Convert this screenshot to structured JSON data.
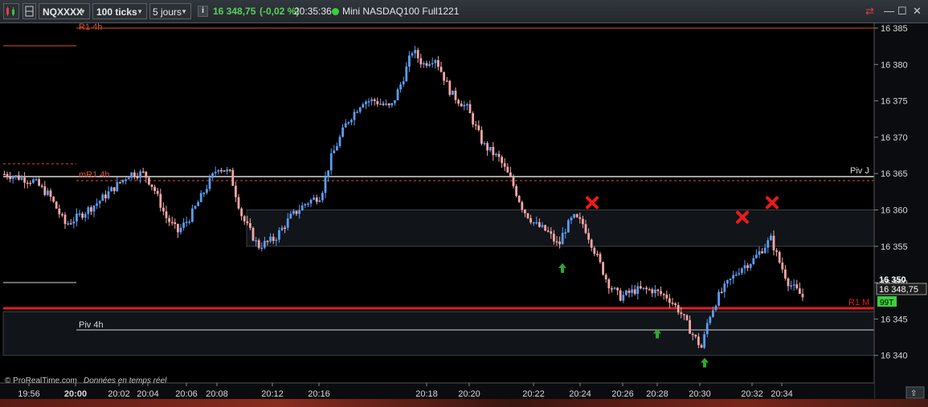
{
  "toolbar": {
    "symbol": "NQXXXX",
    "ticks": "100 ticks",
    "period": "5 jours",
    "price": "16 348,75",
    "change": "(-0,02 %)",
    "time": "20:35:36",
    "instrument": "Mini NASDAQ100 Full1221",
    "info_icon": "i"
  },
  "chart": {
    "copyright": "© ProRealTime.com",
    "data_note": "Données en temps réel",
    "current_price": "16 348,75",
    "current_price_display": "16 350",
    "tick_counter": "99T",
    "y_ticks": [
      "16 385",
      "16 380",
      "16 375",
      "16 370",
      "16 365",
      "16 360",
      "16 355",
      "16 350",
      "16 345",
      "16 340"
    ],
    "x_ticks": [
      "19:56",
      "20:00",
      "20:02",
      "20:04",
      "20:06",
      "20:08",
      "20:12",
      "20:16",
      "20:18",
      "20:20",
      "20:22",
      "20:24",
      "20:26",
      "20:28",
      "20:30",
      "20:32",
      "20:34"
    ],
    "levels": {
      "r1_4h": "R1 4h",
      "mr1_4h": "mR1 4h",
      "piv_j": "Piv J",
      "r1_m": "R1 M",
      "piv_4h": "Piv 4h"
    },
    "colors": {
      "up": "#5b9cf0",
      "down": "#f3a6a6",
      "resistance": "#e0502a",
      "r1m": "#e81b1b",
      "pivot": "#d8d8d8",
      "buy_signal": "#2ea82e",
      "sell_signal": "#e81b1b"
    }
  },
  "chart_data": {
    "type": "candlestick",
    "y_range": [
      16338,
      16387
    ],
    "price_path": [
      [
        2,
        16365
      ],
      [
        40,
        16364
      ],
      [
        60,
        16362
      ],
      [
        80,
        16358
      ],
      [
        95,
        16359
      ],
      [
        120,
        16361
      ],
      [
        140,
        16363
      ],
      [
        160,
        16365
      ],
      [
        178,
        16365
      ],
      [
        190,
        16363
      ],
      [
        205,
        16359
      ],
      [
        220,
        16357
      ],
      [
        235,
        16359
      ],
      [
        255,
        16363
      ],
      [
        270,
        16366
      ],
      [
        285,
        16365
      ],
      [
        300,
        16359
      ],
      [
        320,
        16355
      ],
      [
        340,
        16356
      ],
      [
        360,
        16359
      ],
      [
        380,
        16361
      ],
      [
        398,
        16362
      ],
      [
        410,
        16367
      ],
      [
        430,
        16372
      ],
      [
        450,
        16375
      ],
      [
        465,
        16375
      ],
      [
        485,
        16374
      ],
      [
        500,
        16378
      ],
      [
        512,
        16382
      ],
      [
        525,
        16380
      ],
      [
        540,
        16381
      ],
      [
        560,
        16376
      ],
      [
        580,
        16374
      ],
      [
        600,
        16369
      ],
      [
        620,
        16367
      ],
      [
        635,
        16364
      ],
      [
        650,
        16360
      ],
      [
        665,
        16358
      ],
      [
        680,
        16357
      ],
      [
        694,
        16355
      ],
      [
        700,
        16357
      ],
      [
        712,
        16359
      ],
      [
        725,
        16358
      ],
      [
        740,
        16354
      ],
      [
        755,
        16350
      ],
      [
        770,
        16348
      ],
      [
        790,
        16349
      ],
      [
        810,
        16349
      ],
      [
        830,
        16348
      ],
      [
        845,
        16346
      ],
      [
        860,
        16343
      ],
      [
        872,
        16341
      ],
      [
        880,
        16345
      ],
      [
        892,
        16348
      ],
      [
        905,
        16350
      ],
      [
        920,
        16352
      ],
      [
        935,
        16353
      ],
      [
        950,
        16355
      ],
      [
        958,
        16356
      ],
      [
        968,
        16353
      ],
      [
        980,
        16350
      ],
      [
        998,
        16348
      ]
    ],
    "horizontal_levels": [
      {
        "label": "R1 4h",
        "value": 16385
      },
      {
        "label": "mR1 4h",
        "value": 16364
      },
      {
        "label": "Piv J",
        "value": 16365
      },
      {
        "label": "R1 M",
        "value": 16346
      },
      {
        "label": "Piv 4h",
        "value": 16343
      }
    ],
    "zones": [
      [
        16355,
        16360
      ],
      [
        16340,
        16346
      ]
    ],
    "buy_signals_price": [
      16353,
      16344,
      16340
    ],
    "sell_signals_price": [
      16361,
      16359,
      16361
    ]
  }
}
